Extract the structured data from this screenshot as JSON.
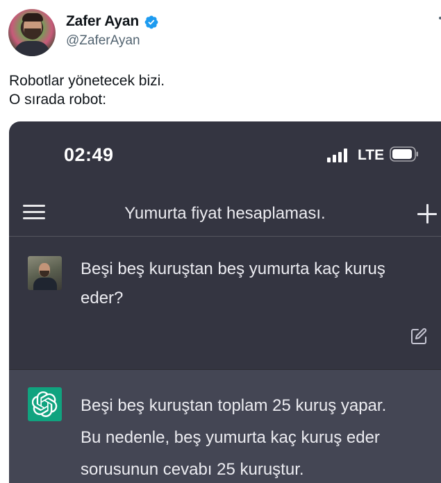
{
  "tweet": {
    "author_name": "Zafer Ayan",
    "author_handle": "@ZaferAyan",
    "verified": true,
    "lines": [
      "Robotlar yönetecek bizi.",
      "O sırada robot:"
    ]
  },
  "phone": {
    "status_time": "02:49",
    "network": "LTE",
    "chat_title": "Yumurta fiyat hesaplaması.",
    "user_message": "Beşi beş kuruştan beş yumurta kaç kuruş eder?",
    "assistant_lines": [
      "Beşi beş kuruştan toplam 25 kuruş yapar.",
      "Bu nedenle, beş yumurta kaç kuruş eder",
      "sorusunun cevabı 25 kuruştur."
    ]
  },
  "colors": {
    "verified_badge": "#1d9bf0",
    "chat_background": "#343541",
    "assistant_background": "#444654",
    "assistant_avatar": "#10a37f"
  },
  "icons": [
    "verified-badge-icon",
    "more-options-icon",
    "signal-bars-icon",
    "battery-icon",
    "hamburger-menu-icon",
    "plus-icon",
    "edit-icon",
    "openai-logo-icon"
  ]
}
